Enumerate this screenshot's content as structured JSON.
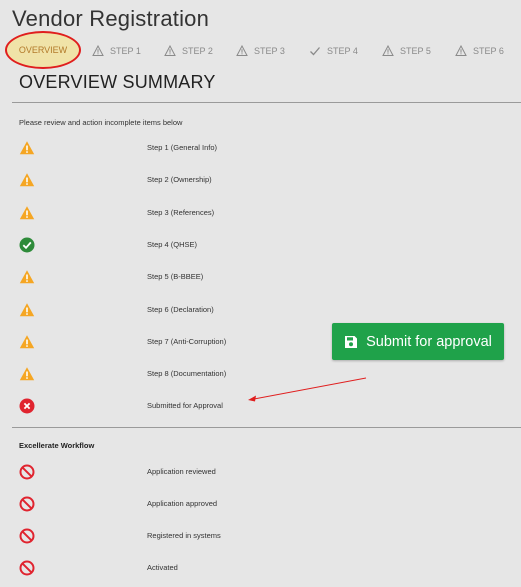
{
  "page_title": "Vendor Registration",
  "tabs": [
    {
      "label": "OVERVIEW",
      "icon": "none",
      "active": true
    },
    {
      "label": "STEP 1",
      "icon": "warning-outline-icon"
    },
    {
      "label": "STEP 2",
      "icon": "warning-outline-icon"
    },
    {
      "label": "STEP 3",
      "icon": "warning-outline-icon"
    },
    {
      "label": "STEP 4",
      "icon": "check-icon"
    },
    {
      "label": "STEP 5",
      "icon": "warning-outline-icon"
    },
    {
      "label": "STEP 6",
      "icon": "warning-outline-icon"
    }
  ],
  "summary": {
    "title": "OVERVIEW SUMMARY",
    "instructions": "Please review and action incomplete items below",
    "items": [
      {
        "label": "Step 1 (General Info)",
        "status": "warning"
      },
      {
        "label": "Step 2 (Ownership)",
        "status": "warning"
      },
      {
        "label": "Step 3 (References)",
        "status": "warning"
      },
      {
        "label": "Step 4 (QHSE)",
        "status": "complete"
      },
      {
        "label": "Step 5 (B-BBEE)",
        "status": "warning"
      },
      {
        "label": "Step 6 (Declaration)",
        "status": "warning"
      },
      {
        "label": "Step 7 (Anti-Corruption)",
        "status": "warning"
      },
      {
        "label": "Step 8 (Documentation)",
        "status": "warning"
      },
      {
        "label": "Submitted for Approval",
        "status": "error"
      }
    ]
  },
  "submit_button": {
    "label": "Submit for approval",
    "icon": "save-icon"
  },
  "workflow": {
    "title": "Excellerate Workflow",
    "items": [
      {
        "label": "Application reviewed",
        "status": "blocked"
      },
      {
        "label": "Application approved",
        "status": "blocked"
      },
      {
        "label": "Registered in systems",
        "status": "blocked"
      },
      {
        "label": "Activated",
        "status": "blocked"
      }
    ]
  },
  "colors": {
    "warning": "#f5a623",
    "complete": "#2e8b3a",
    "error": "#e0242f",
    "blocked": "#e0242f",
    "submit": "#1fa24a",
    "annotation": "#e01e1e"
  }
}
